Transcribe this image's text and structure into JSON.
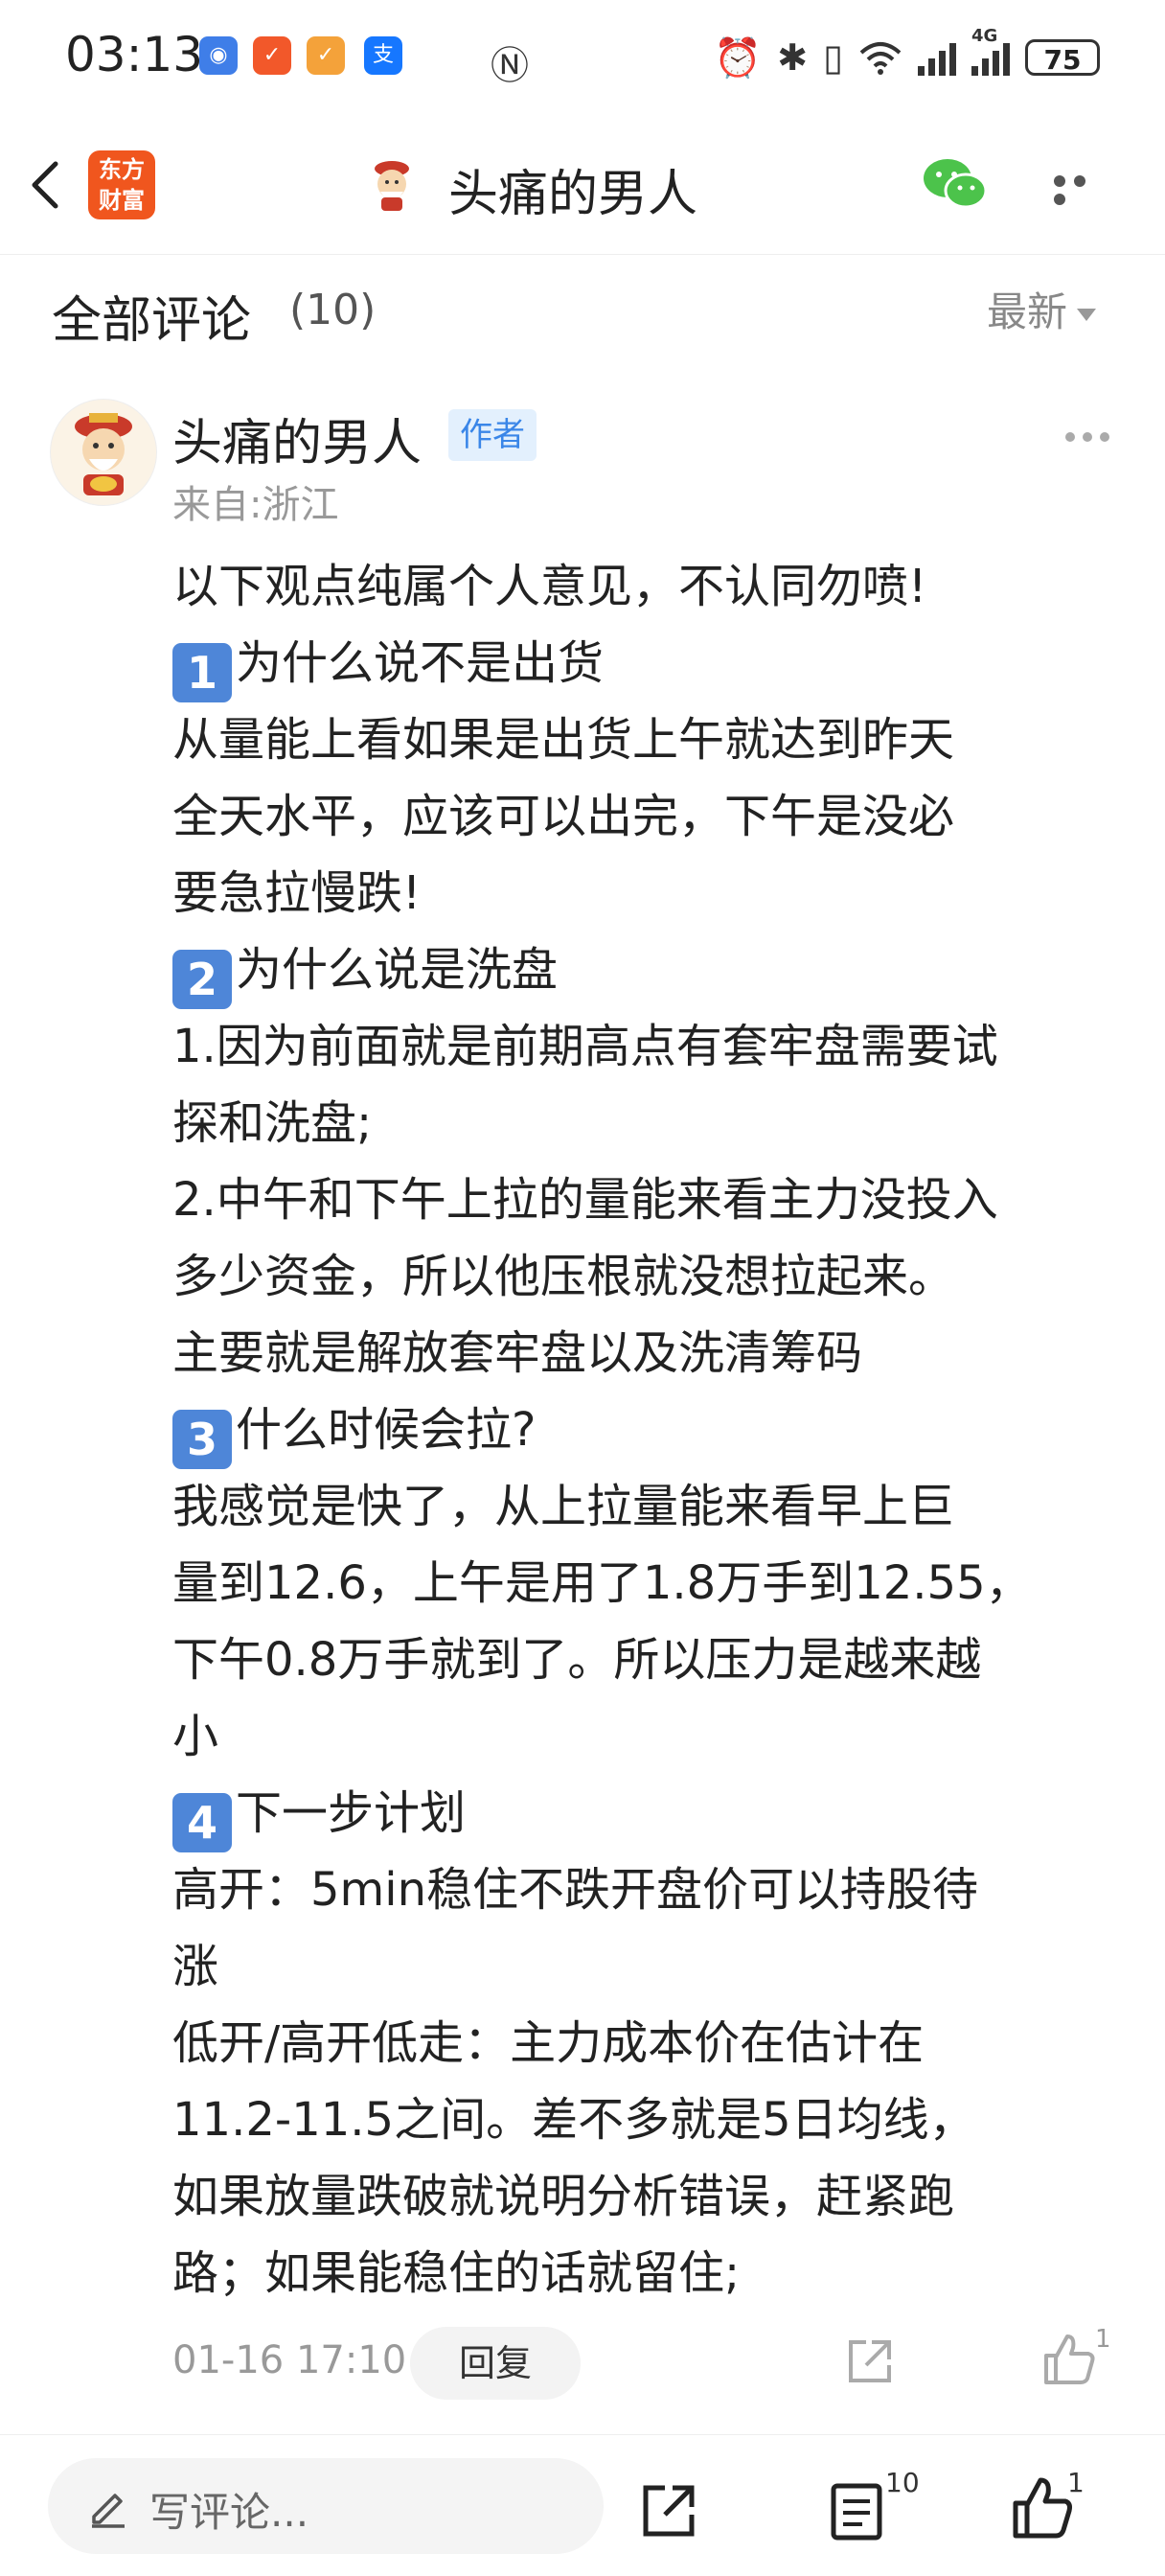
{
  "status_bar": {
    "time": "03:13",
    "battery": "75",
    "network": "4G",
    "icons": [
      "app-blue-icon",
      "app-orange-icon",
      "app-orange2-icon",
      "alipay-icon",
      "nfc-icon",
      "alarm-icon",
      "bluetooth-icon",
      "vibrate-icon",
      "wifi-icon",
      "signal-icon",
      "signal-4g-icon",
      "battery-icon"
    ]
  },
  "nav": {
    "title": "头痛的男人",
    "logo_line1": "东方",
    "logo_line2": "财富"
  },
  "comments": {
    "title": "全部评论",
    "count": "(10)",
    "sort_label": "最新"
  },
  "comment": {
    "user_name": "头痛的男人",
    "author_badge": "作者",
    "location": "来自:浙江",
    "lines": [
      {
        "badge": "",
        "text": "以下观点纯属个人意见，不认同勿喷!"
      },
      {
        "badge": "1",
        "text": "为什么说不是出货"
      },
      {
        "badge": "",
        "text": "从量能上看如果是出货上午就达到昨天"
      },
      {
        "badge": "",
        "text": "全天水平，应该可以出完，下午是没必"
      },
      {
        "badge": "",
        "text": "要急拉慢跌!"
      },
      {
        "badge": "2",
        "text": "为什么说是洗盘"
      },
      {
        "badge": "",
        "text": "1.因为前面就是前期高点有套牢盘需要试"
      },
      {
        "badge": "",
        "text": "探和洗盘;"
      },
      {
        "badge": "",
        "text": "2.中午和下午上拉的量能来看主力没投入"
      },
      {
        "badge": "",
        "text": "多少资金，所以他压根就没想拉起来。"
      },
      {
        "badge": "",
        "text": "主要就是解放套牢盘以及洗清筹码"
      },
      {
        "badge": "3",
        "text": "什么时候会拉?"
      },
      {
        "badge": "",
        "text": "我感觉是快了，从上拉量能来看早上巨"
      },
      {
        "badge": "",
        "text": "量到12.6，上午是用了1.8万手到12.55，"
      },
      {
        "badge": "",
        "text": "下午0.8万手就到了。所以压力是越来越"
      },
      {
        "badge": "",
        "text": "小"
      },
      {
        "badge": "4",
        "text": "下一步计划"
      },
      {
        "badge": "",
        "text": "高开：5min稳住不跌开盘价可以持股待"
      },
      {
        "badge": "",
        "text": "涨"
      },
      {
        "badge": "",
        "text": "低开/高开低走：主力成本价在估计在"
      },
      {
        "badge": "",
        "text": "11.2-11.5之间。差不多就是5日均线，"
      },
      {
        "badge": "",
        "text": "如果放量跌破就说明分析错误，赶紧跑"
      },
      {
        "badge": "",
        "text": "路；如果能稳住的话就留住;"
      }
    ],
    "time": "01-16 17:10",
    "reply_label": "回复",
    "like_count": "1"
  },
  "bottom_bar": {
    "input_placeholder": "写评论...",
    "comment_count": "10",
    "like_count": "1"
  },
  "colors": {
    "accent_blue": "#4e86d8",
    "badge_bg": "#e3f0fd",
    "badge_text": "#3a86e8",
    "logo_orange": "#f0561e",
    "wechat_green": "#4cc34b"
  }
}
